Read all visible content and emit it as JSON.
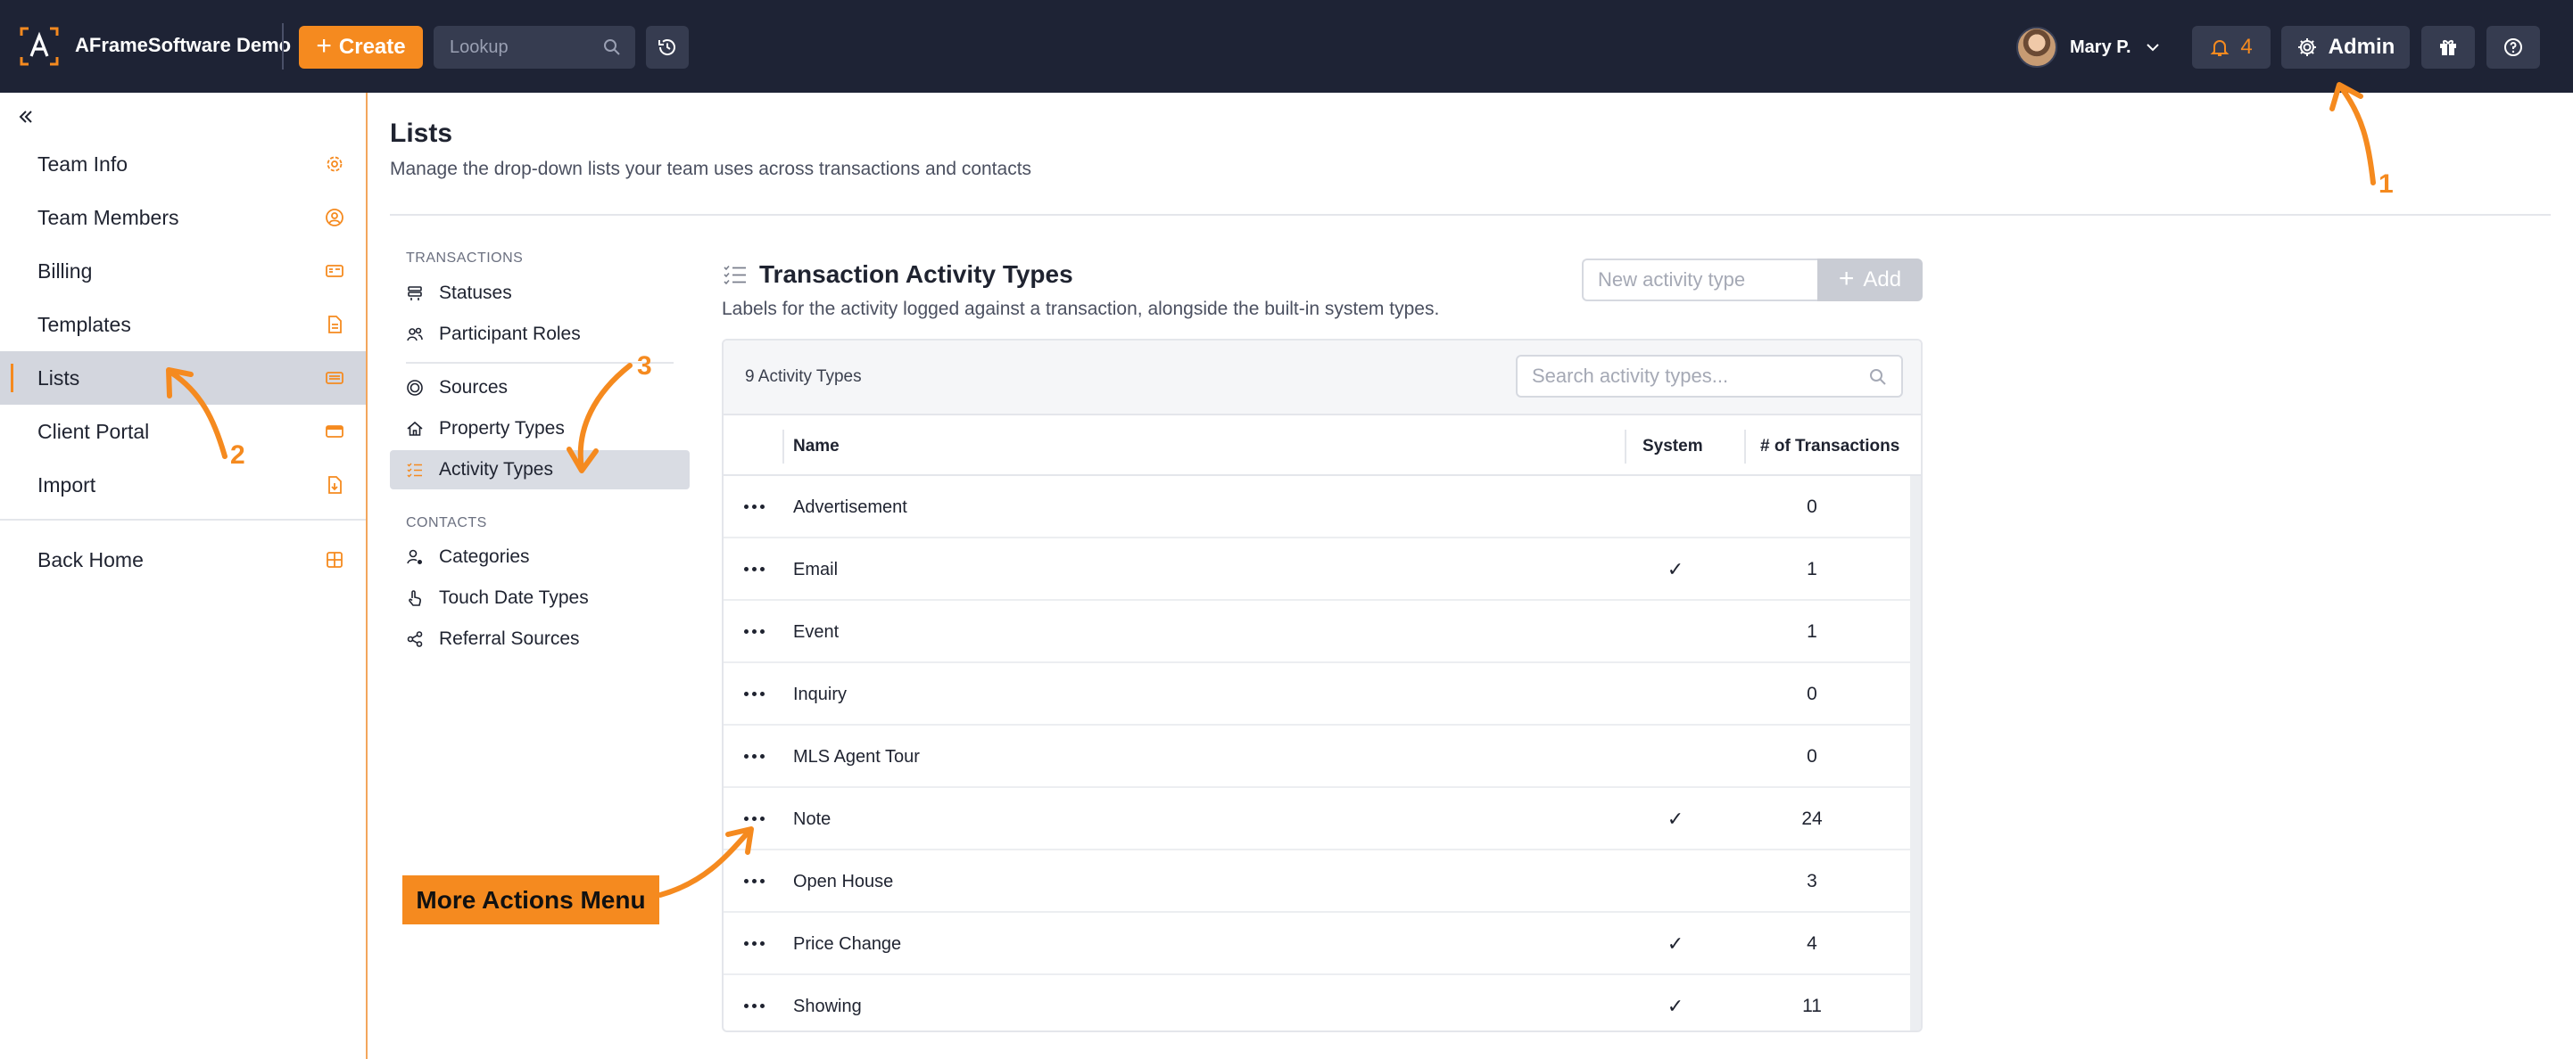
{
  "topbar": {
    "brand": "AFrameSoftware Demo",
    "create_label": "Create",
    "lookup_placeholder": "Lookup",
    "user_name": "Mary P.",
    "notification_count": "4",
    "admin_label": "Admin"
  },
  "sidebar": {
    "items": [
      {
        "label": "Team Info",
        "icon": "gear-icon"
      },
      {
        "label": "Team Members",
        "icon": "user-circle-icon"
      },
      {
        "label": "Billing",
        "icon": "billing-card-icon"
      },
      {
        "label": "Templates",
        "icon": "document-icon"
      },
      {
        "label": "Lists",
        "icon": "list-card-icon",
        "active": true
      },
      {
        "label": "Client Portal",
        "icon": "portal-card-icon"
      },
      {
        "label": "Import",
        "icon": "import-file-icon"
      }
    ],
    "back_home": "Back Home"
  },
  "page": {
    "title": "Lists",
    "subtitle": "Manage the drop-down lists your team uses across transactions and contacts"
  },
  "list_nav": {
    "transactions_label": "TRANSACTIONS",
    "transactions_items": [
      "Statuses",
      "Participant Roles",
      "Sources",
      "Property Types",
      "Activity Types"
    ],
    "contacts_label": "CONTACTS",
    "contacts_items": [
      "Categories",
      "Touch Date Types",
      "Referral Sources"
    ],
    "active_item": "Activity Types"
  },
  "panel": {
    "title": "Transaction Activity Types",
    "subtitle": "Labels for the activity logged against a transaction, alongside the built-in system types.",
    "new_placeholder": "New activity type",
    "add_label": "Add",
    "count_label": "9 Activity Types",
    "search_placeholder": "Search activity types...",
    "columns": {
      "name": "Name",
      "system": "System",
      "transactions": "# of Transactions"
    },
    "rows": [
      {
        "name": "Advertisement",
        "system": "",
        "count": "0"
      },
      {
        "name": "Email",
        "system": "✓",
        "count": "1"
      },
      {
        "name": "Event",
        "system": "",
        "count": "1"
      },
      {
        "name": "Inquiry",
        "system": "",
        "count": "0"
      },
      {
        "name": "MLS Agent Tour",
        "system": "",
        "count": "0"
      },
      {
        "name": "Note",
        "system": "✓",
        "count": "24"
      },
      {
        "name": "Open House",
        "system": "",
        "count": "3"
      },
      {
        "name": "Price Change",
        "system": "✓",
        "count": "4"
      },
      {
        "name": "Showing",
        "system": "✓",
        "count": "11"
      }
    ]
  },
  "annotations": {
    "one": "1",
    "two": "2",
    "three": "3",
    "callout": "More Actions Menu"
  },
  "colors": {
    "topbar": "#1e2335",
    "accent": "#f58a1f",
    "active_row": "#d3d6de"
  }
}
